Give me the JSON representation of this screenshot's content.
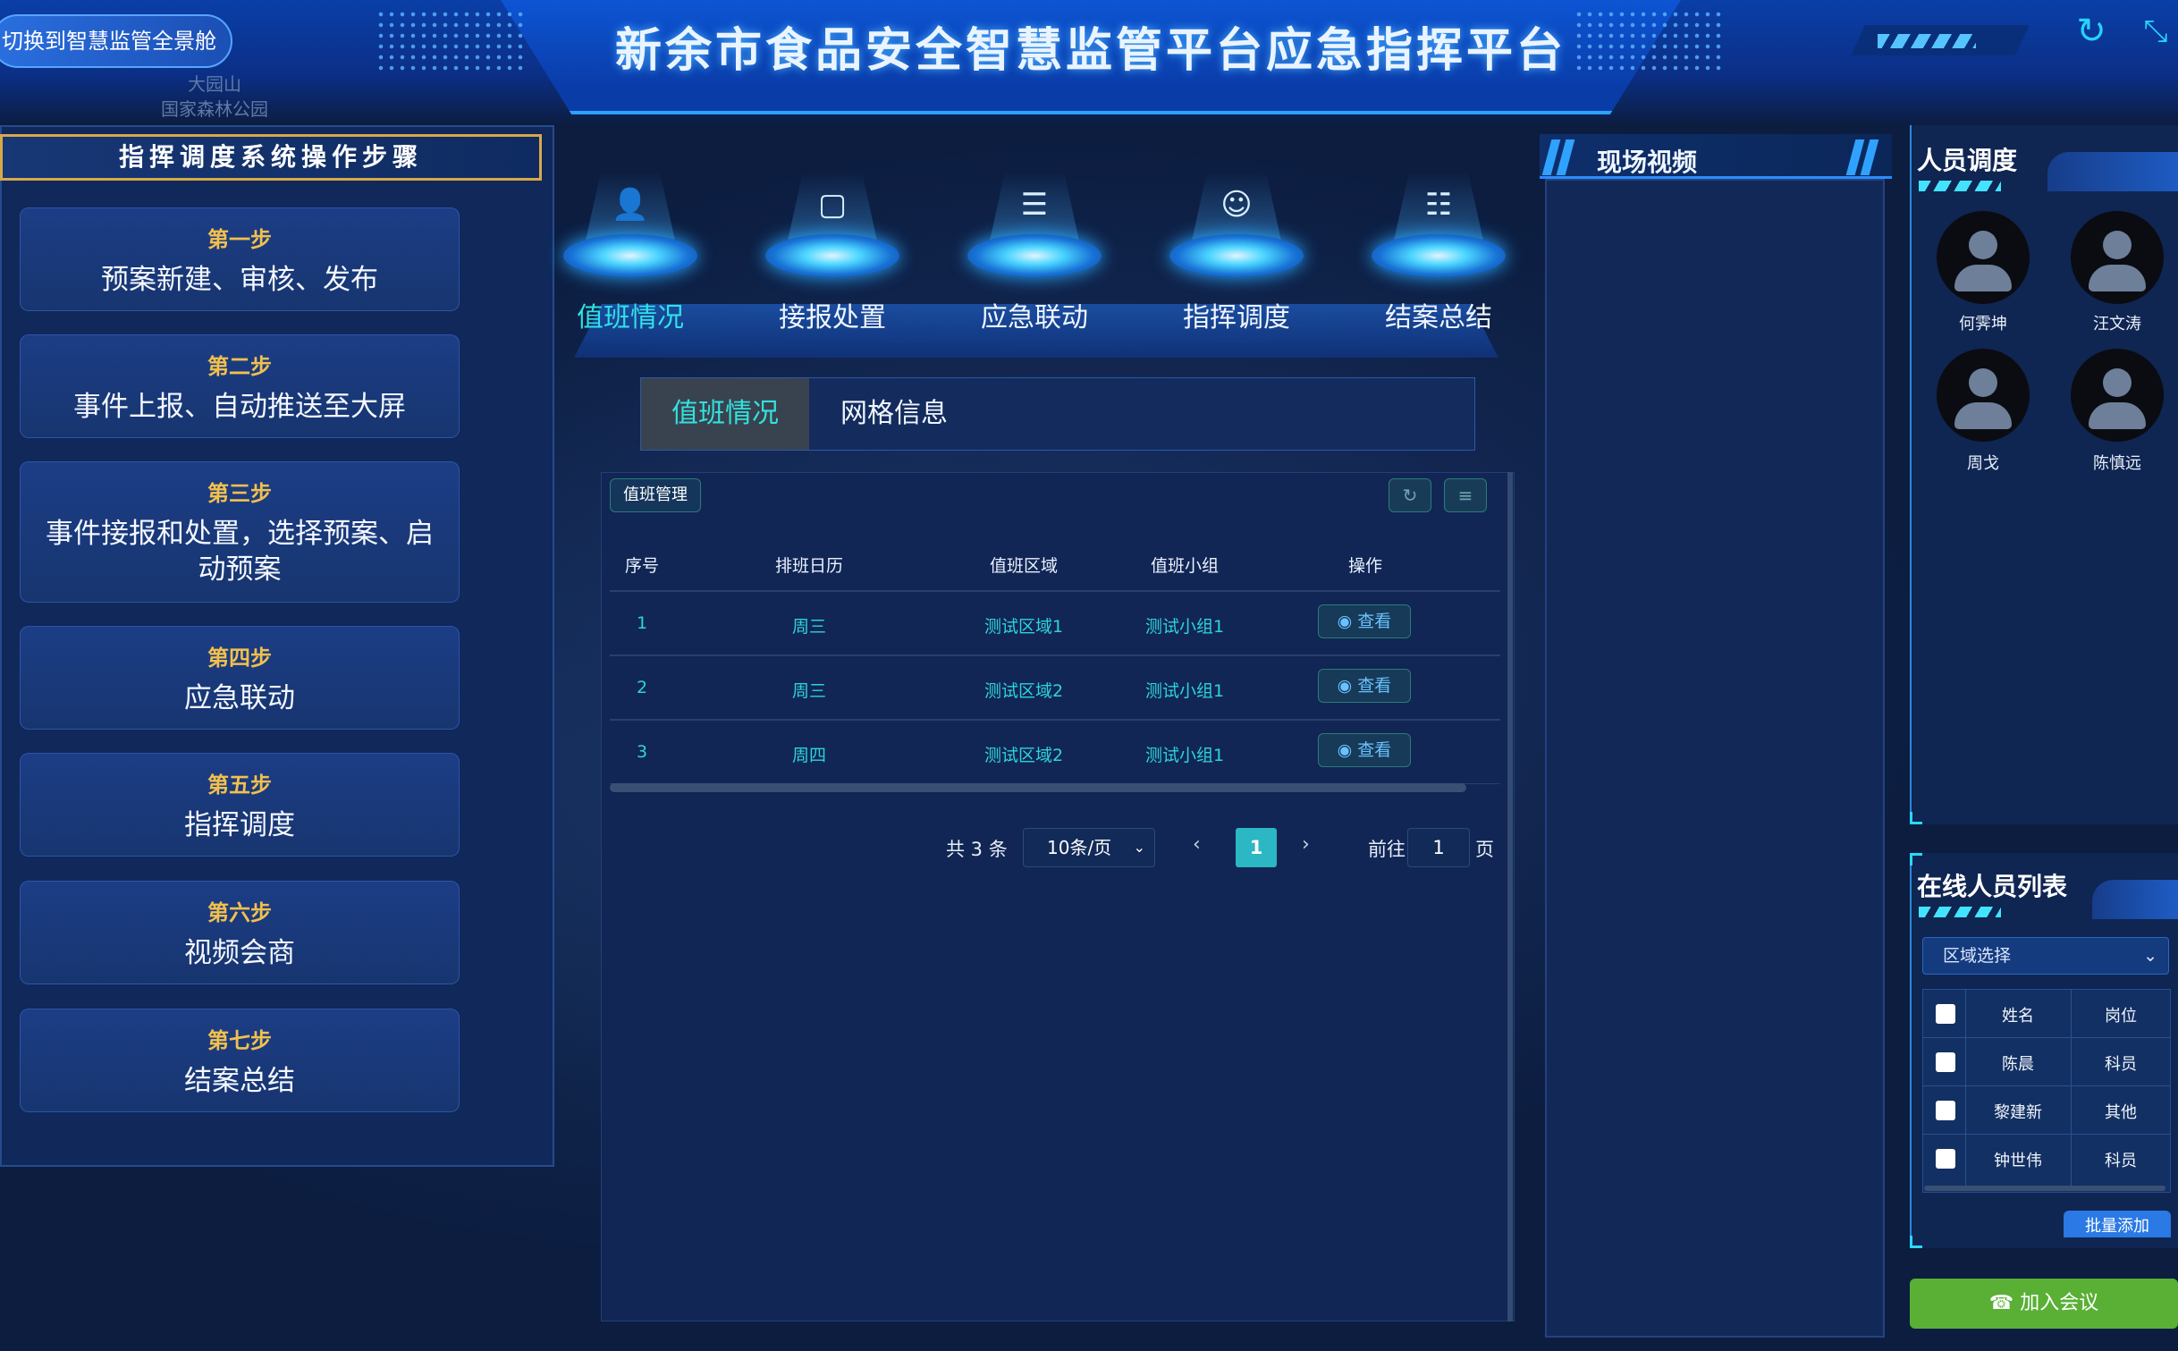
{
  "header": {
    "title": "新余市食品安全智慧监管平台应急指挥平台",
    "switch_label": "切换到智慧监管全景舱",
    "faint_top": "大园山",
    "faint_bottom": "国家森林公园",
    "refresh_icon": "refresh-icon",
    "collapse_icon": "collapse-icon"
  },
  "left_panel": {
    "title": "指挥调度系统操作步骤",
    "steps": [
      {
        "n": "第一步",
        "t": "预案新建、审核、发布"
      },
      {
        "n": "第二步",
        "t": "事件上报、自动推送至大屏"
      },
      {
        "n": "第三步",
        "t": "事件接报和处置，选择预案、启动预案"
      },
      {
        "n": "第四步",
        "t": "应急联动"
      },
      {
        "n": "第五步",
        "t": "指挥调度"
      },
      {
        "n": "第六步",
        "t": "视频会商"
      },
      {
        "n": "第七步",
        "t": "结案总结"
      }
    ]
  },
  "nav": {
    "items": [
      {
        "label": "值班情况",
        "icon": "duty-user-icon"
      },
      {
        "label": "接报处置",
        "icon": "monitor-icon"
      },
      {
        "label": "应急联动",
        "icon": "server-link-icon"
      },
      {
        "label": "指挥调度",
        "icon": "group-icon"
      },
      {
        "label": "结案总结",
        "icon": "document-icon"
      }
    ],
    "active": "值班情况"
  },
  "tabs": [
    "值班情况",
    "网格信息"
  ],
  "table": {
    "chip": "值班管理",
    "columns": [
      "序号",
      "排班日历",
      "值班区域",
      "值班小组",
      "操作"
    ],
    "rows": [
      [
        "1",
        "周三",
        "测试区域1",
        "测试小组1",
        "查看"
      ],
      [
        "2",
        "周三",
        "测试区域2",
        "测试小组1",
        "查看"
      ],
      [
        "3",
        "周四",
        "测试区域2",
        "测试小组1",
        "查看"
      ]
    ]
  },
  "pagination": {
    "total": "共 3 条",
    "page_size": "10条/页",
    "current": "1",
    "goto_label": "前往",
    "goto_value": "1",
    "page_suffix": "页"
  },
  "video": {
    "title": "现场视频"
  },
  "personnel": {
    "title": "人员调度",
    "people": [
      "何霁坤",
      "汪文涛",
      "周戈",
      "陈慎远"
    ]
  },
  "online": {
    "title": "在线人员列表",
    "region_placeholder": "区域选择",
    "columns": [
      "姓名",
      "岗位"
    ],
    "rows": [
      [
        "陈晨",
        "科员"
      ],
      [
        "黎建新",
        "其他"
      ],
      [
        "钟世伟",
        "科员"
      ]
    ],
    "batch_add": "批量添加"
  },
  "join_meeting": "加入会议",
  "colors": {
    "accent": "#30e0e6",
    "gold": "#f2c04d",
    "join": "#59b035"
  }
}
